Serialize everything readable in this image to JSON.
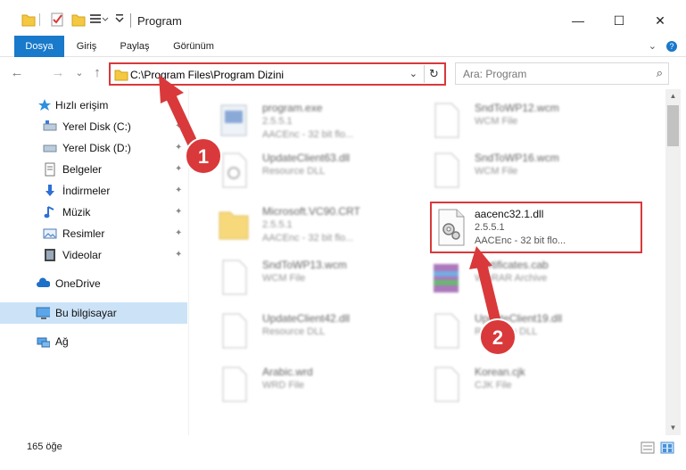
{
  "window": {
    "title": "Program",
    "minimize": "—",
    "maximize": "☐",
    "close": "✕"
  },
  "ribbon": {
    "tabs": [
      "Dosya",
      "Giriş",
      "Paylaş",
      "Görünüm"
    ],
    "help": "?",
    "expand": "⌄"
  },
  "nav": {
    "back": "←",
    "forward": "→",
    "recent": "⌄",
    "up": "↑"
  },
  "address": {
    "path": "C:\\Program Files\\Program Dizini",
    "dropdown": "⌄",
    "refresh": "↻"
  },
  "search": {
    "placeholder": "Ara: Program",
    "icon": "⌕"
  },
  "sidebar": {
    "items": [
      {
        "label": "Hızlı erişim",
        "icon": "star-icon"
      },
      {
        "label": "Yerel Disk (C:)",
        "icon": "drive-icon",
        "pinned": true
      },
      {
        "label": "Yerel Disk (D:)",
        "icon": "drive-icon",
        "pinned": true
      },
      {
        "label": "Belgeler",
        "icon": "documents-icon",
        "pinned": true
      },
      {
        "label": "İndirmeler",
        "icon": "download-icon",
        "pinned": true
      },
      {
        "label": "Müzik",
        "icon": "music-icon",
        "pinned": true
      },
      {
        "label": "Resimler",
        "icon": "pictures-icon",
        "pinned": true
      },
      {
        "label": "Videolar",
        "icon": "videos-icon",
        "pinned": true
      },
      {
        "label": "OneDrive",
        "icon": "cloud-icon"
      },
      {
        "label": "Bu bilgisayar",
        "icon": "computer-icon"
      },
      {
        "label": "Ağ",
        "icon": "network-icon"
      }
    ],
    "pin_glyph": "📌"
  },
  "files": [
    {
      "name": "program.exe",
      "line2": "2.5.5.1",
      "line3": "AACEnc - 32 bit flo..."
    },
    {
      "name": "SndToWP12.wcm",
      "line2": "WCM File",
      "line3": ""
    },
    {
      "name": "UpdateClient63.dll",
      "line2": "Resource DLL",
      "line3": ""
    },
    {
      "name": "SndToWP16.wcm",
      "line2": "WCM File",
      "line3": ""
    },
    {
      "name": "Microsoft.VC90.CRT",
      "line2": "2.5.5.1",
      "line3": "AACEnc - 32 bit flo..."
    },
    {
      "name": "SndToWP13.wcm",
      "line2": "WCM File",
      "line3": ""
    },
    {
      "name": "Certificates.cab",
      "line2": "WinRAR Archive",
      "line3": ""
    },
    {
      "name": "UpdateClient42.dll",
      "line2": "Resource DLL",
      "line3": ""
    },
    {
      "name": "UpdateClient19.dll",
      "line2": "Resource DLL",
      "line3": ""
    },
    {
      "name": "Arabic.wrd",
      "line2": "WRD File",
      "line3": ""
    },
    {
      "name": "Korean.cjk",
      "line2": "CJK File",
      "line3": ""
    }
  ],
  "highlighted_file": {
    "name": "aacenc32.1.dll",
    "line2": "2.5.5.1",
    "line3": "AACEnc - 32 bit flo..."
  },
  "status": {
    "count": "165 öğe"
  },
  "annotations": {
    "badge1": "1",
    "badge2": "2",
    "color": "#d9393a"
  }
}
